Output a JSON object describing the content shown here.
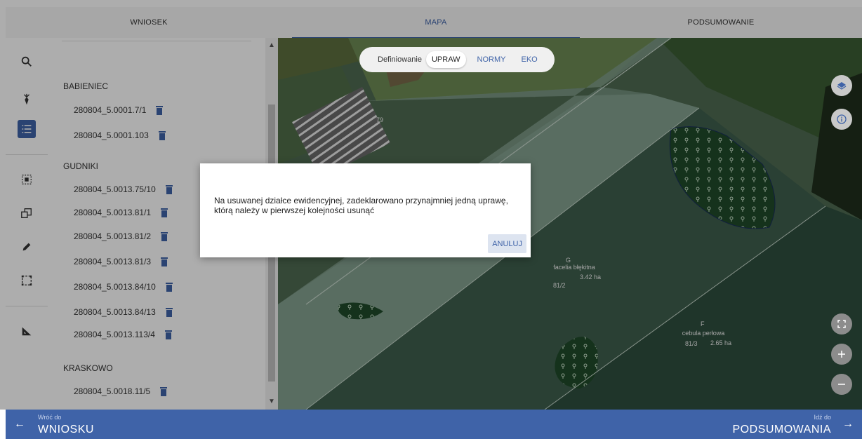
{
  "tabs": [
    {
      "label": "WNIOSEK"
    },
    {
      "label": "MAPA"
    },
    {
      "label": "PODSUMOWANIE"
    }
  ],
  "toolbar": {
    "icons": [
      "search-icon",
      "plant-icon",
      "list-icon",
      "select-area-icon",
      "copy-icon",
      "pencil-icon",
      "polygon-select-icon",
      "ruler-triangle-icon"
    ]
  },
  "parcels": {
    "groups": [
      {
        "name": "BABIENIEC",
        "items": [
          "280804_5.0001.7/1",
          "280804_5.0001.103"
        ]
      },
      {
        "name": "GUDNIKI",
        "items": [
          "280804_5.0013.75/10",
          "280804_5.0013.81/1",
          "280804_5.0013.81/2",
          "280804_5.0013.81/3",
          "280804_5.0013.84/10",
          "280804_5.0013.84/13",
          "280804_5.0013.113/4"
        ]
      },
      {
        "name": "KRASKOWO",
        "items": [
          "280804_5.0018.11/5"
        ]
      }
    ]
  },
  "mode": {
    "label": "Definiowanie",
    "options": [
      "UPRAW",
      "NORMY",
      "EKO"
    ],
    "selected": "UPRAW"
  },
  "map": {
    "labels": {
      "l79": "79",
      "g_code": "G",
      "g_crop": "facelia błękitna",
      "g_area": "3.42 ha",
      "g_parcel": "81/2",
      "f_code": "F",
      "f_crop": "cebula perłowa",
      "f_area": "2.65 ha",
      "f_parcel": "81/3"
    }
  },
  "dialog": {
    "message": "Na usuwanej działce ewidencyjnej, zadeklarowano przynajmniej jedną uprawę, którą należy w pierwszej kolejności usunąć",
    "cancel": "ANULUJ"
  },
  "footer": {
    "back_small": "Wróć do",
    "back_large": "WNIOSKU",
    "next_small": "Idź do",
    "next_large": "PODSUMOWANIA"
  },
  "colors": {
    "accent": "#3f63a8"
  }
}
